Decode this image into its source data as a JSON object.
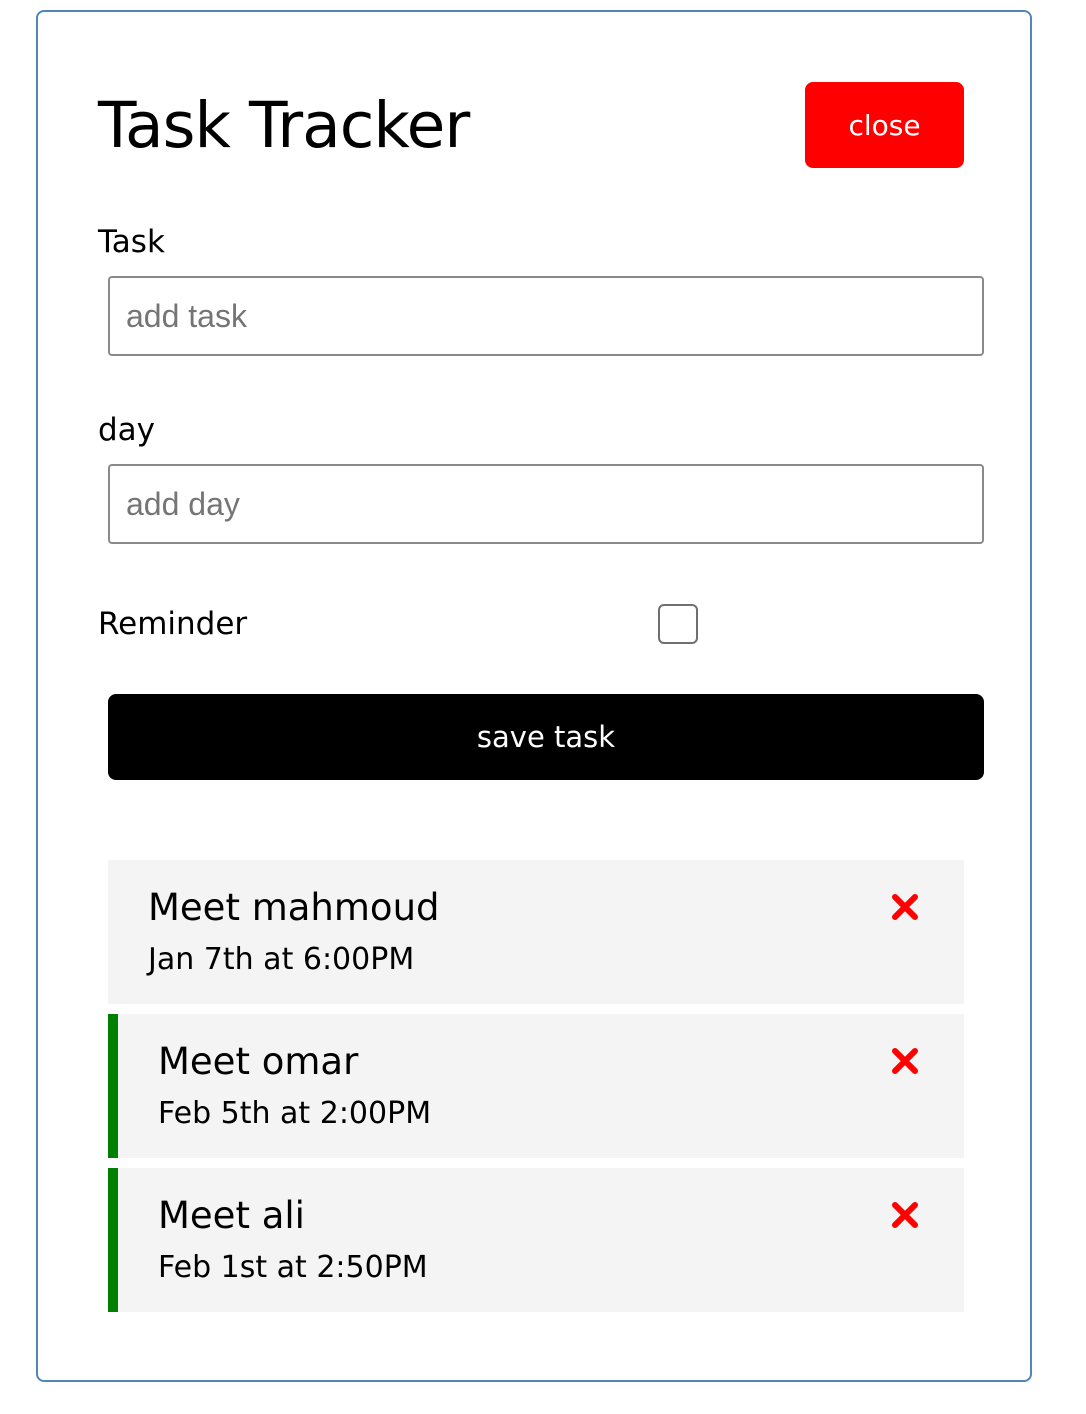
{
  "header": {
    "title": "Task Tracker",
    "close_label": "close"
  },
  "form": {
    "task_label": "Task",
    "task_placeholder": "add task",
    "task_value": "",
    "day_label": "day",
    "day_placeholder": "add day",
    "day_value": "",
    "reminder_label": "Reminder",
    "reminder_checked": false,
    "save_label": "save task"
  },
  "tasks": [
    {
      "title": "Meet mahmoud",
      "day": "Jan 7th at 6:00PM",
      "reminder": false
    },
    {
      "title": "Meet omar",
      "day": "Feb 5th at 2:00PM",
      "reminder": true
    },
    {
      "title": "Meet ali",
      "day": "Feb 1st at 2:50PM",
      "reminder": true
    }
  ],
  "colors": {
    "close_button": "#ff0000",
    "save_button": "#000000",
    "reminder_border": "#008000",
    "delete_icon": "#ff0000",
    "task_background": "#f4f4f4",
    "container_border": "#4f87b8"
  },
  "icons": {
    "delete": "close-x-icon"
  }
}
